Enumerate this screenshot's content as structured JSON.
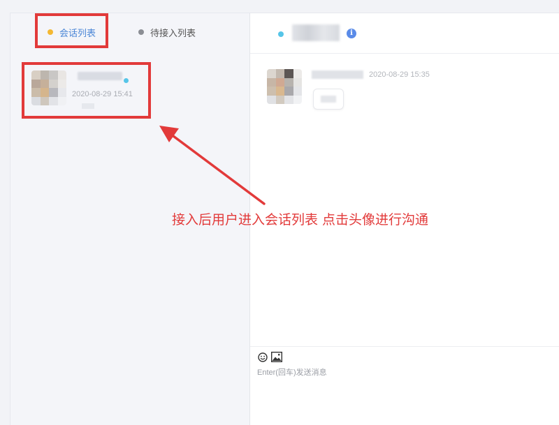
{
  "tabs": [
    {
      "label": "会话列表",
      "active": true,
      "dot_color": "#f4b832"
    },
    {
      "label": "待接入列表",
      "active": false,
      "dot_color": "#8b8e94"
    }
  ],
  "conversation_list": [
    {
      "time": "2020-08-29 15:41",
      "online": true
    }
  ],
  "chat": {
    "header_info_icon": "info-icon",
    "messages": [
      {
        "time": "2020-08-29 15:35"
      }
    ]
  },
  "annotation": {
    "text": "接入后用户进入会话列表 点击头像进行沟通",
    "color": "#e23a3a"
  },
  "input": {
    "placeholder": "Enter(回车)发送消息",
    "tools": [
      "emoji-icon",
      "image-icon"
    ]
  },
  "colors": {
    "accent": "#4a86d6",
    "online": "#56c5e8",
    "highlight": "#e23a3a"
  }
}
